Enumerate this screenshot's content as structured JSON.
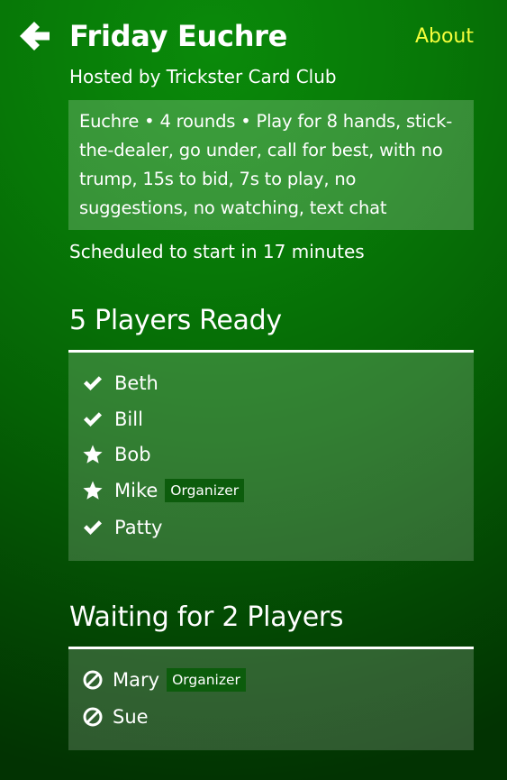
{
  "header": {
    "title": "Friday Euchre",
    "about_label": "About",
    "back_icon": "arrow-left-icon"
  },
  "host": "Hosted by Trickster Card Club",
  "description": "Euchre • 4 rounds • Play for 8 hands, stick-the-dealer, go under, call for best, with no trump, 15s to bid, 7s to play, no suggestions, no watching, text chat",
  "schedule": "Scheduled to start in 17 minutes",
  "ready": {
    "heading": "5 Players Ready",
    "players": [
      {
        "name": "Beth",
        "icon": "check-icon",
        "badge": ""
      },
      {
        "name": "Bill",
        "icon": "check-icon",
        "badge": ""
      },
      {
        "name": "Bob",
        "icon": "star-icon",
        "badge": ""
      },
      {
        "name": "Mike",
        "icon": "star-icon",
        "badge": "Organizer"
      },
      {
        "name": "Patty",
        "icon": "check-icon",
        "badge": ""
      }
    ]
  },
  "waiting": {
    "heading": "Waiting for 2 Players",
    "players": [
      {
        "name": "Mary",
        "icon": "prohibited-icon",
        "badge": "Organizer"
      },
      {
        "name": "Sue",
        "icon": "prohibited-icon",
        "badge": ""
      }
    ]
  },
  "colors": {
    "accent": "#f6ff3c",
    "badge_bg": "#0c5c0c",
    "background": "#077807"
  }
}
